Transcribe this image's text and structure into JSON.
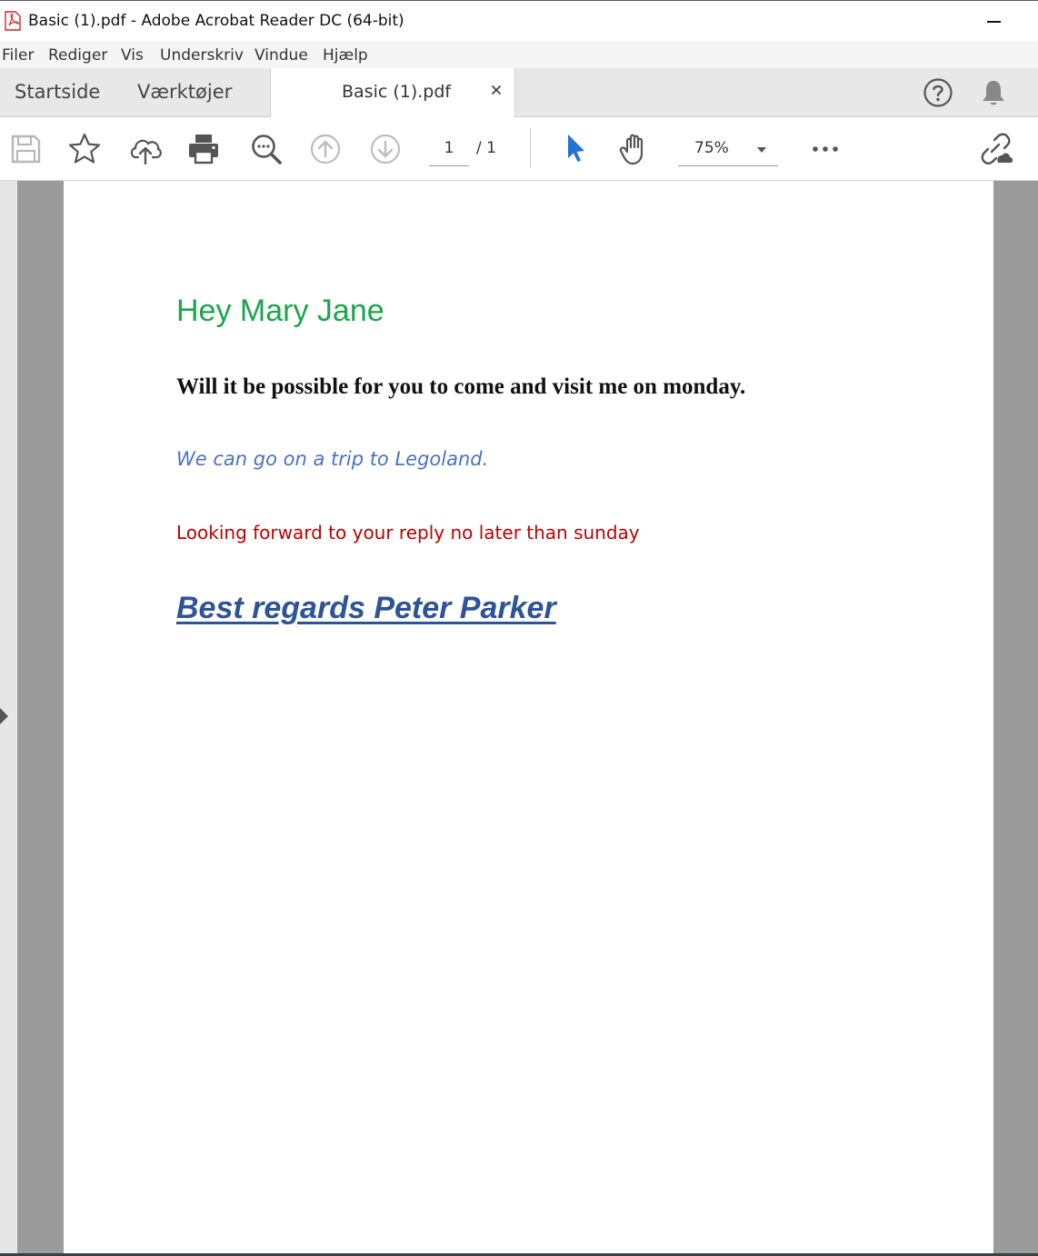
{
  "window": {
    "title": "Basic (1).pdf - Adobe Acrobat Reader DC (64-bit)",
    "app_icon": "acrobat-pdf-icon"
  },
  "menu": {
    "items": [
      "Filer",
      "Rediger",
      "Vis",
      "Underskriv",
      "Vindue",
      "Hjælp"
    ]
  },
  "tabs": {
    "home": "Startside",
    "tools": "Værktøjer",
    "document": "Basic (1).pdf"
  },
  "toolbar": {
    "icons": [
      "save-icon",
      "star-icon",
      "upload-cloud-icon",
      "print-icon",
      "zoom-search-icon",
      "page-up-icon",
      "page-down-icon",
      "select-cursor-icon",
      "hand-tool-icon",
      "more-icon",
      "share-link-icon"
    ],
    "current_page": "1",
    "page_total": "/  1",
    "zoom": "75%"
  },
  "document": {
    "greeting": "Hey Mary Jane",
    "question": "Will it be possible for you to come and visit me on monday.",
    "suggestion": "We can go on a trip to Legoland.",
    "request": "Looking forward to your reply no later than sunday",
    "signoff": "Best regards Peter Parker"
  },
  "colors": {
    "accent_blue": "#2473d6",
    "greeting": "#1aa64b",
    "suggestion": "#4a72c0",
    "request": "#c00000",
    "signoff": "#2f5496"
  }
}
